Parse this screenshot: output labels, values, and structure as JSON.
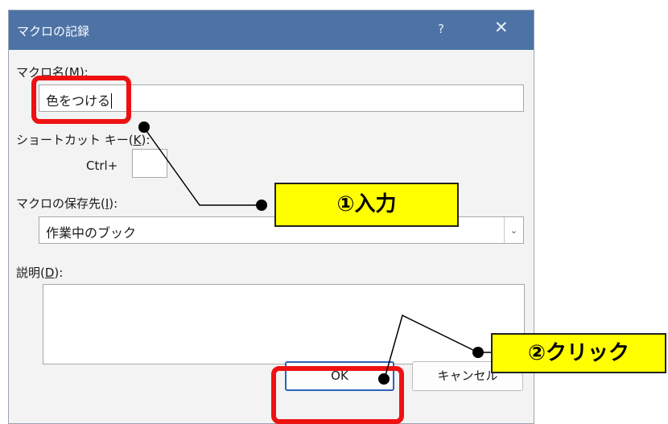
{
  "dialog": {
    "title": "マクロの記録",
    "help_glyph": "?",
    "close_glyph": "✕"
  },
  "macro_name": {
    "label_prefix": "マクロ名(",
    "label_key": "M",
    "label_suffix": "):",
    "value": "色をつける"
  },
  "shortcut": {
    "label_prefix": "ショートカット キー(",
    "label_key": "K",
    "label_suffix": "):",
    "modifier": "Ctrl+",
    "value": ""
  },
  "store_in": {
    "label_prefix": "マクロの保存先(",
    "label_key": "I",
    "label_suffix": "):",
    "selected": "作業中のブック"
  },
  "description": {
    "label_prefix": "説明(",
    "label_key": "D",
    "label_suffix": "):",
    "value": ""
  },
  "buttons": {
    "ok": "OK",
    "cancel": "キャンセル"
  },
  "callouts": {
    "step1": "①入力",
    "step2": "②クリック"
  },
  "colors": {
    "titlebar": "#4d73a6",
    "highlight": "#ee1111",
    "callout_fill": "#ffff00"
  }
}
